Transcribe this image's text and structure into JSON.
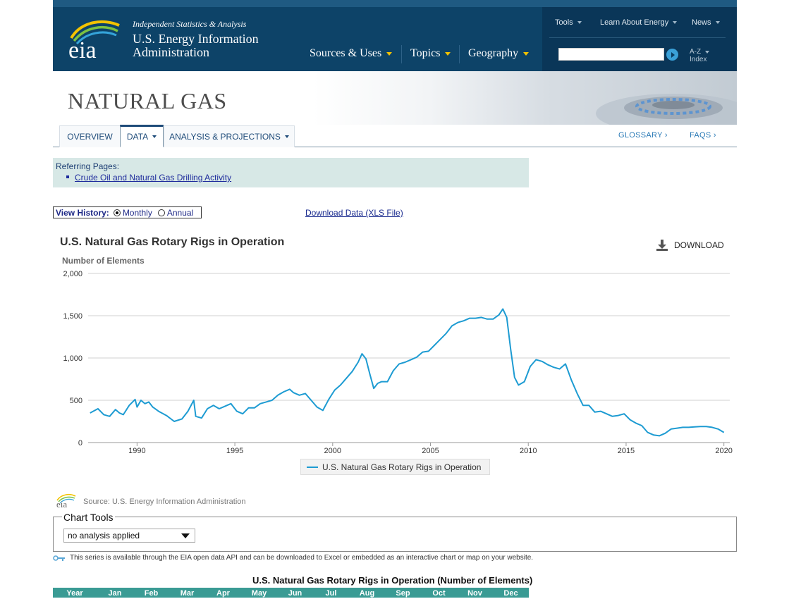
{
  "header": {
    "tagline": "Independent Statistics & Analysis",
    "agency_line1": "U.S. Energy Information",
    "agency_line2": "Administration",
    "logo_text": "eia",
    "nav_main": [
      "Sources & Uses",
      "Topics",
      "Geography"
    ],
    "nav_top": [
      "Tools",
      "Learn About Energy",
      "News"
    ],
    "search_placeholder": "",
    "az_line1": "A-Z",
    "az_line2": "Index"
  },
  "banner": {
    "title": "NATURAL GAS"
  },
  "tabs": [
    {
      "label": "OVERVIEW",
      "active": false
    },
    {
      "label": "DATA",
      "active": true
    },
    {
      "label": "ANALYSIS & PROJECTIONS",
      "active": false
    }
  ],
  "tabs_right": {
    "glossary": "GLOSSARY ›",
    "faqs": "FAQS ›"
  },
  "referring": {
    "title": "Referring Pages:",
    "link": "Crude Oil and Natural Gas Drilling Activity"
  },
  "view_history": {
    "label": "View History:",
    "options": [
      {
        "label": "Monthly",
        "selected": true
      },
      {
        "label": "Annual",
        "selected": false
      }
    ]
  },
  "download_data_link": "Download Data (XLS File)",
  "chart": {
    "title": "U.S. Natural Gas Rotary Rigs in Operation",
    "download_label": "DOWNLOAD",
    "ylabel": "Number of Elements",
    "legend": "U.S. Natural Gas Rotary Rigs in Operation",
    "source_text": "Source: U.S. Energy Information Administration"
  },
  "chart_data": {
    "type": "line",
    "title": "U.S. Natural Gas Rotary Rigs in Operation",
    "ylabel": "Number of Elements",
    "xlabel": "",
    "ylim": [
      0,
      2000
    ],
    "xlim": [
      1987.5,
      2020.3
    ],
    "y_ticks": [
      "0",
      "500",
      "1,000",
      "1,500",
      "2,000"
    ],
    "x_ticks": [
      "1990",
      "1995",
      "2000",
      "2005",
      "2010",
      "2015",
      "2020"
    ],
    "grid": true,
    "legend_position": "bottom",
    "color": "#1d9bd2",
    "series": [
      {
        "name": "U.S. Natural Gas Rotary Rigs in Operation",
        "x": [
          1987.6,
          1988.0,
          1988.3,
          1988.6,
          1988.9,
          1989.1,
          1989.3,
          1989.6,
          1989.9,
          1990.0,
          1990.2,
          1990.4,
          1990.6,
          1990.8,
          1991.1,
          1991.5,
          1991.9,
          1992.3,
          1992.6,
          1992.9,
          1993.0,
          1993.3,
          1993.6,
          1993.9,
          1994.2,
          1994.5,
          1994.8,
          1995.1,
          1995.4,
          1995.7,
          1996.0,
          1996.3,
          1996.6,
          1996.9,
          1997.2,
          1997.5,
          1997.8,
          1998.0,
          1998.3,
          1998.6,
          1998.9,
          1999.2,
          1999.5,
          1999.8,
          2000.1,
          2000.4,
          2000.7,
          2001.0,
          2001.3,
          2001.5,
          2001.7,
          2001.9,
          2002.1,
          2002.3,
          2002.5,
          2002.8,
          2003.1,
          2003.4,
          2003.7,
          2004.0,
          2004.3,
          2004.6,
          2004.9,
          2005.2,
          2005.5,
          2005.8,
          2006.1,
          2006.4,
          2006.7,
          2007.0,
          2007.3,
          2007.6,
          2007.9,
          2008.2,
          2008.5,
          2008.7,
          2008.9,
          2009.1,
          2009.3,
          2009.5,
          2009.8,
          2010.1,
          2010.4,
          2010.7,
          2011.0,
          2011.3,
          2011.6,
          2011.9,
          2012.2,
          2012.5,
          2012.8,
          2013.1,
          2013.4,
          2013.7,
          2014.0,
          2014.3,
          2014.6,
          2014.9,
          2015.2,
          2015.5,
          2015.8,
          2016.1,
          2016.4,
          2016.7,
          2017.0,
          2017.3,
          2017.6,
          2017.9,
          2018.2,
          2018.5,
          2018.8,
          2019.1,
          2019.4,
          2019.7,
          2020.0
        ],
        "values": [
          350,
          400,
          330,
          310,
          390,
          350,
          330,
          440,
          510,
          420,
          500,
          460,
          480,
          420,
          370,
          320,
          250,
          280,
          370,
          500,
          310,
          290,
          400,
          440,
          400,
          430,
          460,
          370,
          340,
          410,
          410,
          460,
          480,
          500,
          560,
          600,
          630,
          590,
          560,
          580,
          500,
          420,
          380,
          510,
          620,
          680,
          760,
          840,
          950,
          1050,
          990,
          810,
          640,
          700,
          720,
          720,
          850,
          930,
          950,
          980,
          1010,
          1070,
          1080,
          1150,
          1220,
          1290,
          1380,
          1420,
          1440,
          1470,
          1470,
          1480,
          1460,
          1460,
          1510,
          1580,
          1480,
          1100,
          770,
          680,
          720,
          900,
          980,
          960,
          920,
          890,
          870,
          930,
          740,
          580,
          440,
          440,
          360,
          370,
          340,
          310,
          320,
          340,
          270,
          230,
          200,
          120,
          90,
          80,
          110,
          160,
          170,
          180,
          180,
          185,
          190,
          190,
          180,
          160,
          120
        ]
      }
    ]
  },
  "chart_tools": {
    "legend": "Chart Tools",
    "selected": "no analysis applied"
  },
  "api_note": "This series is available through the EIA open data API and can be downloaded to Excel or embedded as an interactive chart or map on your website.",
  "table": {
    "title": "U.S. Natural Gas Rotary Rigs in Operation (Number of Elements)",
    "headers": [
      "Year",
      "Jan",
      "Feb",
      "Mar",
      "Apr",
      "May",
      "Jun",
      "Jul",
      "Aug",
      "Sep",
      "Oct",
      "Nov",
      "Dec"
    ]
  }
}
